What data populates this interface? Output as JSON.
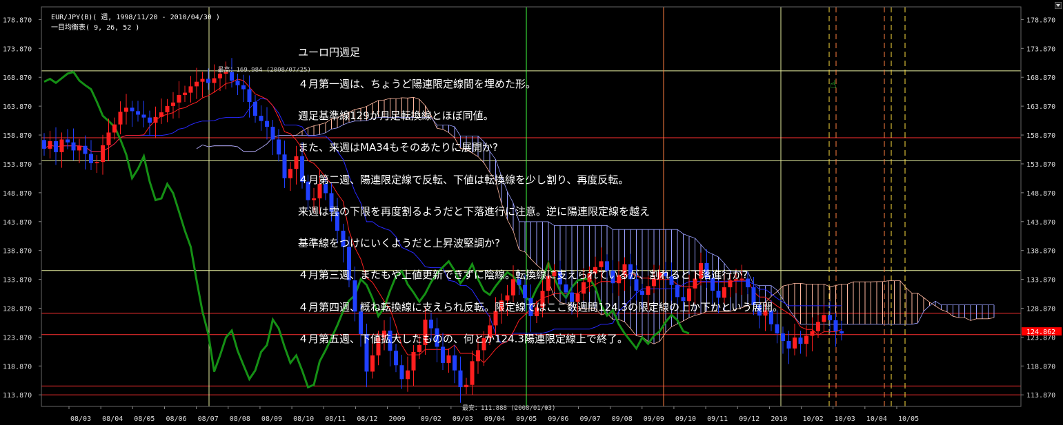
{
  "header": {
    "symbol": "EUR/JPY(B)( 週, 1998/11/20 - 2010/04/30 )",
    "indicator": "一目均衡表( 9, 26, 52 )"
  },
  "note_lines": [
    "ユーロ円週足",
    "４月第一週は、ちょうど陽連限定線間を埋めた形。",
    "週足基準線129が月足転換線とほぼ同値。",
    "また、来週はMA34もそのあたりに展開か?",
    "４月第二週、陽連限定線で反転、下値は転換線を少し割り、再度反転。",
    "来週は雲の下限を再度割るようだと下落進行に注意。逆に陽連限定線を越え",
    "基準線をつけにいくようだと上昇波堅調か?",
    "４月第三週、またもや上値更新できずに陰線。転換線に支えられているが、割れると下落進行か?",
    "４月第四週、概ね転換線に支えられ反転。限定線ではここ数週間124.3の限定線の上か下かという展開。",
    "４月第五週、下値拡大したものの、何とか124.3陽連限定線上で終了。"
  ],
  "annotations": {
    "high_label": "最高：169.984 (2008/07/25)",
    "low_label": "最安：111.888 (2008/01/03)",
    "last_price": "124.862"
  },
  "colors": {
    "background": "#000000",
    "up_candle": "#ff1f1f",
    "down_candle": "#2040ff",
    "tenkan": "#ff2020",
    "kijun": "#2828ff",
    "chikou": "#159015",
    "cloud_a": "#ffb8a0",
    "cloud_b": "#9aa0ff",
    "price_tag": "#ff0000"
  },
  "chart_data": {
    "type": "candlestick",
    "ylim": [
      111.87,
      179.87
    ],
    "yticks": [
      "178.870",
      "173.870",
      "168.870",
      "163.870",
      "158.870",
      "153.870",
      "148.870",
      "143.870",
      "138.870",
      "133.870",
      "128.870",
      "123.870",
      "118.870",
      "113.870"
    ],
    "xticks": [
      "08/03",
      "08/04",
      "08/05",
      "08/06",
      "08/07",
      "08/08",
      "08/09",
      "08/10",
      "08/11",
      "08/12",
      "2009",
      "09/02",
      "09/03",
      "09/04",
      "09/05",
      "09/06",
      "09/07",
      "09/08",
      "09/09",
      "09/10",
      "09/11",
      "09/12",
      "2010",
      "10/02",
      "10/03",
      "10/04",
      "10/05"
    ],
    "hlines": [
      169.98,
      158.4,
      154.4,
      135.4,
      128.0,
      124.3,
      115.4,
      113.87
    ],
    "last_price": 124.862,
    "series_closes": [
      156.5,
      157.8,
      155.9,
      158.1,
      157.6,
      156.2,
      157.0,
      155.6,
      154.0,
      154.2,
      157.1,
      159.3,
      160.7,
      162.9,
      163.6,
      163.0,
      162.4,
      161.9,
      161.0,
      162.0,
      162.8,
      163.9,
      164.5,
      165.8,
      166.2,
      167.3,
      168.1,
      168.6,
      167.9,
      168.7,
      169.5,
      169.8,
      168.3,
      167.5,
      166.8,
      164.6,
      162.2,
      161.3,
      160.3,
      158.1,
      155.5,
      151.4,
      153.0,
      155.2,
      150.8,
      147.6,
      147.9,
      150.4,
      148.8,
      145.6,
      142.3,
      139.5,
      133.7,
      128.3,
      124.4,
      117.9,
      120.7,
      123.8,
      125.0,
      121.5,
      119.0,
      116.6,
      118.1,
      121.3,
      122.5,
      126.9,
      125.4,
      122.2,
      119.4,
      120.7,
      118.1,
      115.2,
      115.6,
      119.7,
      121.6,
      123.7,
      125.9,
      128.4,
      130.2,
      131.1,
      133.9,
      132.9,
      130.6,
      127.5,
      129.0,
      131.9,
      134.4,
      135.3,
      133.0,
      131.6,
      130.0,
      131.4,
      133.4,
      134.9,
      136.0,
      137.0,
      135.4,
      133.2,
      134.6,
      136.5,
      133.9,
      131.9,
      131.2,
      132.7,
      134.0,
      135.1,
      134.4,
      132.9,
      130.8,
      130.1,
      132.3,
      134.0,
      136.7,
      134.1,
      131.9,
      130.7,
      132.5,
      133.7,
      133.9,
      134.0,
      132.5,
      129.4,
      127.6,
      128.5,
      126.1,
      124.5,
      123.2,
      121.9,
      123.8,
      122.7,
      124.1,
      124.9,
      126.5,
      127.7,
      126.8,
      124.9,
      124.5
    ],
    "series_opens": [
      158.0,
      156.5,
      157.8,
      155.9,
      158.1,
      157.6,
      156.2,
      157.0,
      155.6,
      154.0,
      154.2,
      157.1,
      159.3,
      160.7,
      162.9,
      163.6,
      163.0,
      162.4,
      161.9,
      161.0,
      162.0,
      162.8,
      163.9,
      164.5,
      165.8,
      166.2,
      167.3,
      168.1,
      168.6,
      167.9,
      168.7,
      169.5,
      169.8,
      168.3,
      167.5,
      166.8,
      164.6,
      162.2,
      161.3,
      160.3,
      158.1,
      155.5,
      151.4,
      153.0,
      155.2,
      150.8,
      147.6,
      147.9,
      150.4,
      148.8,
      145.6,
      142.3,
      139.5,
      133.7,
      128.3,
      124.4,
      117.9,
      120.7,
      123.8,
      125.0,
      121.5,
      119.0,
      116.6,
      118.1,
      121.3,
      122.5,
      126.9,
      125.4,
      122.2,
      119.4,
      120.7,
      118.1,
      115.2,
      115.6,
      119.7,
      121.6,
      123.7,
      125.9,
      128.4,
      130.2,
      131.1,
      133.9,
      132.9,
      130.6,
      127.5,
      129.0,
      131.9,
      134.4,
      135.3,
      133.0,
      131.6,
      130.0,
      131.4,
      133.4,
      134.9,
      136.0,
      137.0,
      135.4,
      133.2,
      134.6,
      136.5,
      133.9,
      131.9,
      131.2,
      132.7,
      134.0,
      135.1,
      134.4,
      132.9,
      130.8,
      130.1,
      132.3,
      134.0,
      136.7,
      134.1,
      131.9,
      130.7,
      132.5,
      133.7,
      133.9,
      134.0,
      132.5,
      129.4,
      127.6,
      128.5,
      126.1,
      124.5,
      123.2,
      121.9,
      123.8,
      122.7,
      124.1,
      124.9,
      126.5,
      127.7,
      126.8,
      124.9
    ]
  }
}
